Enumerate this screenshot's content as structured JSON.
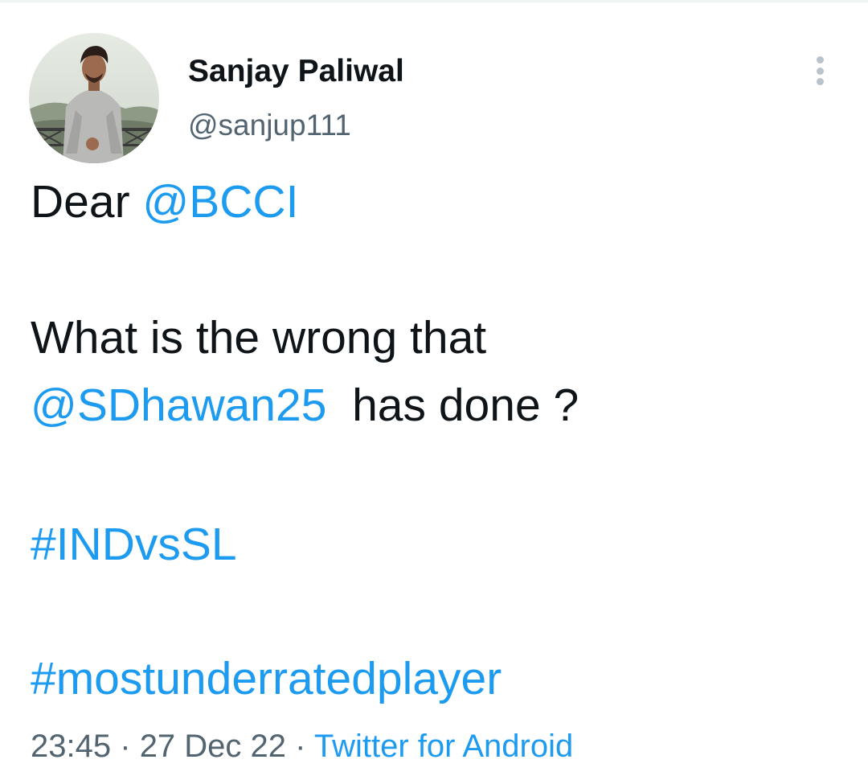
{
  "author": {
    "display_name": "Sanjay Paliwal",
    "handle": "@sanjup111",
    "avatar": "profile-photo"
  },
  "menu": {
    "icon": "more-vertical-icon"
  },
  "tweet": {
    "greeting": "Dear",
    "mention_1": "@BCCI",
    "question_1": "What is the wrong that",
    "mention_2": "@SDhawan25",
    "question_2": "has done ?",
    "hashtag_1": "#INDvsSL",
    "hashtag_2": "#mostunderratedplayer"
  },
  "meta": {
    "time": "23:45",
    "separator_1": "·",
    "date": "27 Dec 22",
    "separator_2": "·",
    "source": "Twitter for Android"
  },
  "colors": {
    "link": "#1d9bf0",
    "text": "#0f1419",
    "secondary": "#536471"
  }
}
